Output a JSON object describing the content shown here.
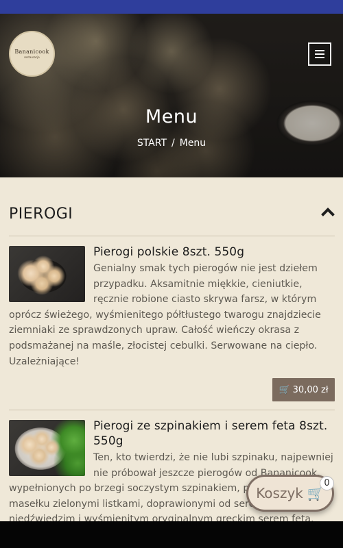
{
  "logo": {
    "text": "Bananicook",
    "sub": "restauracja"
  },
  "hero": {
    "title": "Menu",
    "breadcrumb": [
      "START",
      "Menu"
    ],
    "separator": "/"
  },
  "section": {
    "title": "PIEROGI"
  },
  "items": [
    {
      "title": "Pierogi polskie 8szt. 550g",
      "description": "Genialny smak tych pierogów nie jest dziełem przypadku. Aksamitnie miękkie, cieniutkie, ręcznie robione ciasto skrywa farsz, w którym oprócz świeżego, wyśmienitego półtłustego twarogu znajdziecie ziemniaki ze sprawdzonych upraw. Całość wieńczy okrasa z podsmażanej na maśle, złocistej cebulki. Serwowane na ciepło. Uzależniające!",
      "price": "30,00 zł"
    },
    {
      "title": "Pierogi ze szpinakiem i serem feta 8szt. 550g",
      "description": "Ten, kto twierdzi, że nie lubi szpinaku, najpewniej nie próbował jeszcze pierogów od Bananicook, wypełnionych po brzegi soczystym szpinakiem, podsmażonym na masełku zielonymi listkami, doprawionymi od serca czosnkiem niedźwiedzim i wyśmienitym oryginalnym greckim serem feta."
    }
  ],
  "cart": {
    "label": "Koszyk",
    "count": "0"
  },
  "colors": {
    "accent": "#2f3e9c",
    "button": "#7b6b5e",
    "background": "#efe8d8"
  },
  "icons": {
    "menu": "bars-icon",
    "collapse": "chevron-up-icon",
    "cart": "shopping-cart-icon"
  }
}
